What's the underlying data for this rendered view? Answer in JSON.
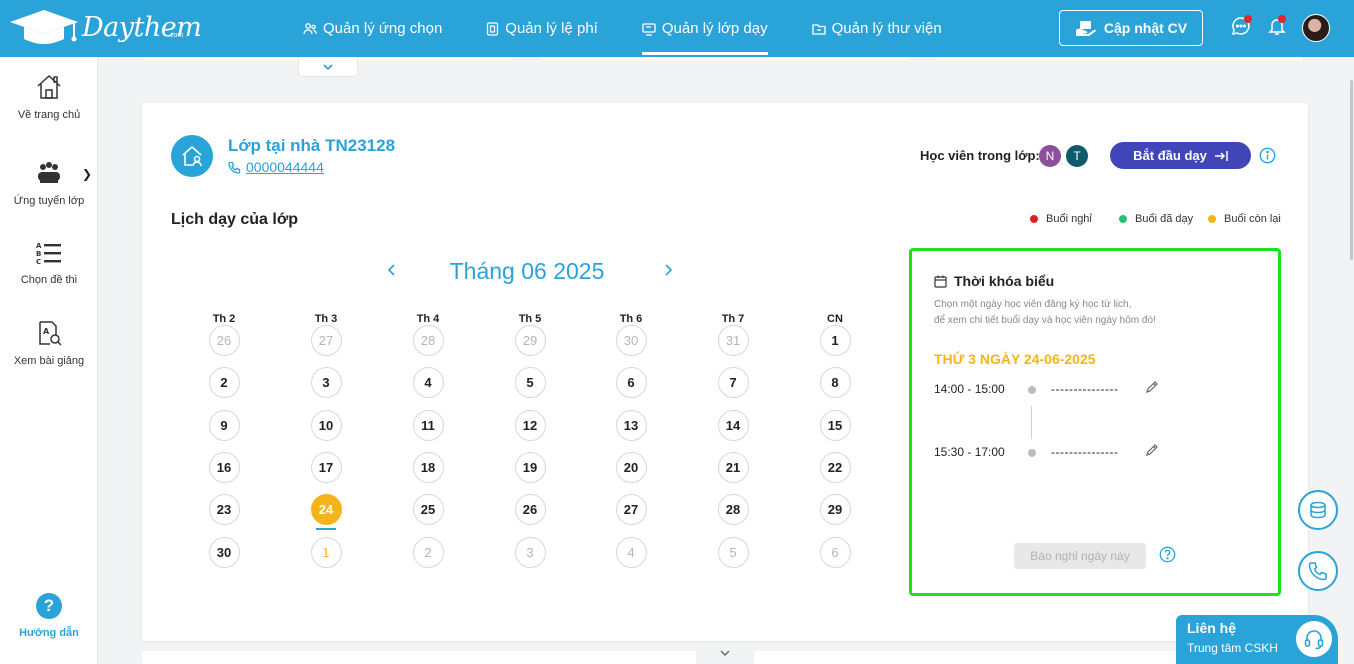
{
  "brand": {
    "name": "Daythem",
    "suffix": ".com"
  },
  "nav": {
    "items": [
      {
        "label": "Quản lý ứng chọn",
        "icon": "users-icon"
      },
      {
        "label": "Quản lý lệ phí",
        "icon": "fee-icon"
      },
      {
        "label": "Quản lý lớp dạy",
        "icon": "classroom-icon",
        "active": true
      },
      {
        "label": "Quản lý thư viện",
        "icon": "library-icon"
      }
    ],
    "cv_button": "Cập nhật CV"
  },
  "sidebar": {
    "items": [
      {
        "label": "Về trang chủ",
        "icon": "home-icon"
      },
      {
        "label": "Ứng tuyển lớp",
        "icon": "group-icon"
      },
      {
        "label": "Chọn đề thi",
        "icon": "list-abc-icon"
      },
      {
        "label": "Xem bài giảng",
        "icon": "lesson-search-icon"
      }
    ],
    "help": {
      "label": "Hướng dẫn",
      "symbol": "?"
    }
  },
  "class": {
    "title": "Lớp tại nhà TN23128",
    "phone": "0000044444",
    "students_label": "Học viên trong lớp:",
    "students": [
      {
        "initial": "N",
        "color": "#8b4f9e"
      },
      {
        "initial": "T",
        "color": "#0f5a6b"
      }
    ],
    "start_button": "Bắt đầu dạy"
  },
  "schedule": {
    "title": "Lịch dạy của lớp",
    "legend": [
      {
        "label": "Buổi nghỉ",
        "color": "#e02020"
      },
      {
        "label": "Buổi đã dạy",
        "color": "#22c07a"
      },
      {
        "label": "Buổi còn lại",
        "color": "#f5b41a"
      }
    ],
    "month_title": "Tháng 06 2025",
    "weekdays": [
      "Th 2",
      "Th 3",
      "Th 4",
      "Th 5",
      "Th 6",
      "Th 7",
      "CN"
    ],
    "weeks": [
      [
        "26",
        "27",
        "28",
        "29",
        "30",
        "31",
        "1"
      ],
      [
        "2",
        "3",
        "4",
        "5",
        "6",
        "7",
        "8"
      ],
      [
        "9",
        "10",
        "11",
        "12",
        "13",
        "14",
        "15"
      ],
      [
        "16",
        "17",
        "18",
        "19",
        "20",
        "21",
        "22"
      ],
      [
        "23",
        "24",
        "25",
        "26",
        "27",
        "28",
        "29"
      ],
      [
        "30",
        "1",
        "2",
        "3",
        "4",
        "5",
        "6"
      ]
    ],
    "selected_day": "24"
  },
  "timetable": {
    "title": "Thời khóa biểu",
    "hint_line1": "Chọn một ngày học viên đăng ký học từ lịch,",
    "hint_line2": "để xem chi tiết buổi dạy và học viên ngày hôm đó!",
    "date": "THỨ 3 NGÀY 24-06-2025",
    "slots": [
      {
        "time": "14:00 - 15:00",
        "value": "---------------"
      },
      {
        "time": "15:30 - 17:00",
        "value": "---------------"
      }
    ],
    "report_button": "Báo nghỉ ngày này"
  },
  "contact": {
    "title": "Liên hệ",
    "subtitle": "Trung tâm CSKH"
  },
  "colors": {
    "primary": "#29a3d8",
    "accent": "#f5b41a",
    "start_button": "#4045b8",
    "highlight_border": "#1ee11e"
  }
}
